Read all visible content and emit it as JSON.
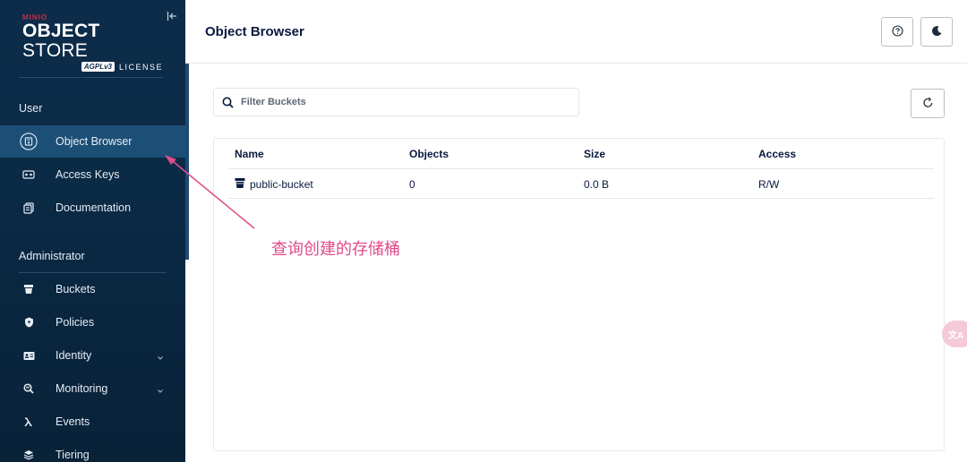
{
  "brand": {
    "minio": "MINIO",
    "product_bold": "OBJECT",
    "product_rest": " STORE",
    "agpl": "AGPLv3",
    "license": "LICENSE"
  },
  "sidebar": {
    "user_section": "User",
    "user_items": [
      {
        "label": "Object Browser",
        "icon": "object-browser-icon",
        "active": true
      },
      {
        "label": "Access Keys",
        "icon": "access-keys-icon"
      },
      {
        "label": "Documentation",
        "icon": "documentation-icon"
      }
    ],
    "admin_section": "Administrator",
    "admin_items": [
      {
        "label": "Buckets",
        "icon": "buckets-icon"
      },
      {
        "label": "Policies",
        "icon": "policies-icon"
      },
      {
        "label": "Identity",
        "icon": "identity-icon",
        "expandable": true
      },
      {
        "label": "Monitoring",
        "icon": "monitoring-icon",
        "expandable": true
      },
      {
        "label": "Events",
        "icon": "lambda-icon"
      },
      {
        "label": "Tiering",
        "icon": "tiering-icon"
      }
    ]
  },
  "header": {
    "title": "Object Browser",
    "help_icon": "help-icon",
    "theme_icon": "dark-mode-icon"
  },
  "filter": {
    "placeholder": "Filter Buckets"
  },
  "table": {
    "columns": [
      "Name",
      "Objects",
      "Size",
      "Access"
    ],
    "rows": [
      {
        "name": "public-bucket",
        "objects": "0",
        "size": "0.0 B",
        "access": "R/W"
      }
    ]
  },
  "annotation": {
    "text": "查询创建的存储桶",
    "color": "#e04b8a"
  },
  "translate_fab": {
    "label": "文A"
  },
  "colors": {
    "sidebar_bg": "#0c2c4a",
    "active_item": "#1c4f75",
    "brand_red": "#c72c48",
    "heading": "#07193e"
  }
}
